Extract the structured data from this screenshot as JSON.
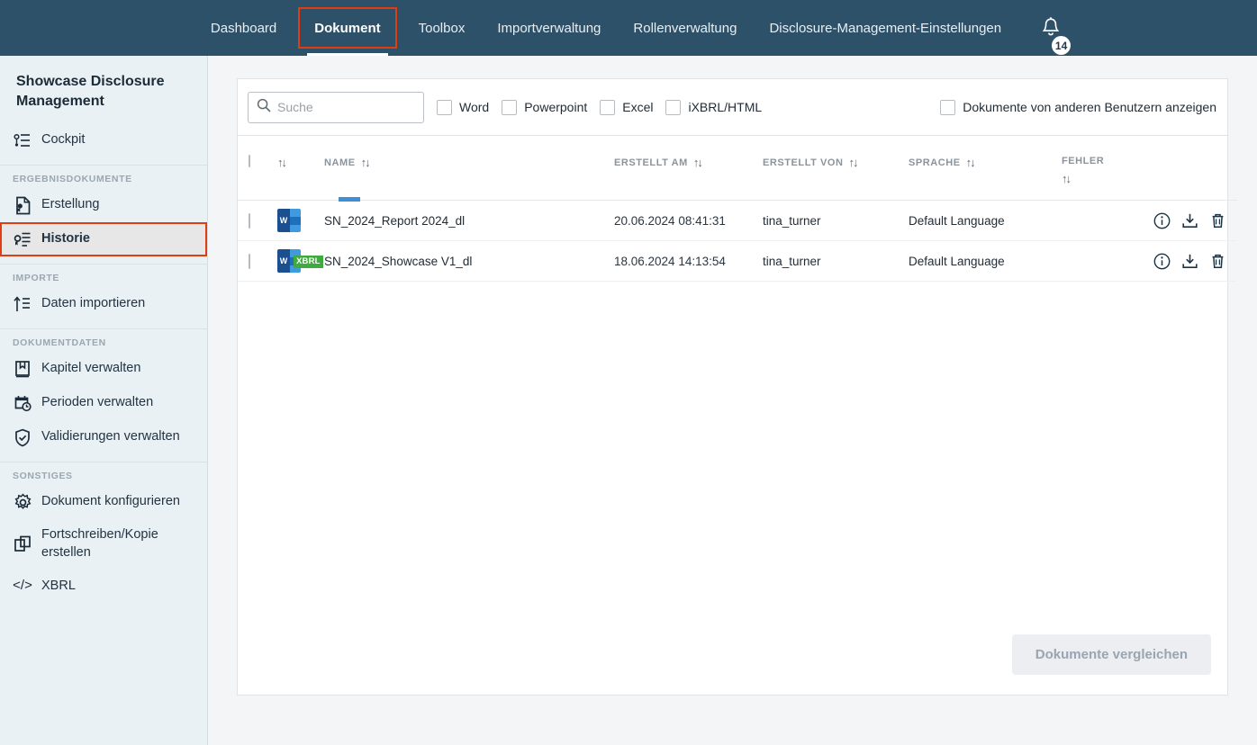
{
  "topnav": {
    "items": [
      {
        "label": "Dashboard",
        "active": false
      },
      {
        "label": "Dokument",
        "active": true
      },
      {
        "label": "Toolbox",
        "active": false
      },
      {
        "label": "Importverwaltung",
        "active": false
      },
      {
        "label": "Rollenverwaltung",
        "active": false
      },
      {
        "label": "Disclosure-Management-Einstellungen",
        "active": false
      }
    ],
    "notification_count": "14",
    "bar_color": "#2d5169",
    "active_highlight_color": "#e03e12"
  },
  "sidebar": {
    "title": "Showcase Disclosure Management",
    "groups": [
      {
        "label": "",
        "items": [
          {
            "label": "Cockpit",
            "icon": "cockpit-icon",
            "active": false
          }
        ]
      },
      {
        "label": "ERGEBNISDOKUMENTE",
        "items": [
          {
            "label": "Erstellung",
            "icon": "document-create-icon",
            "active": false
          },
          {
            "label": "Historie",
            "icon": "document-history-icon",
            "active": true
          }
        ]
      },
      {
        "label": "IMPORTE",
        "items": [
          {
            "label": "Daten importieren",
            "icon": "import-data-icon",
            "active": false
          }
        ]
      },
      {
        "label": "DOKUMENTDATEN",
        "items": [
          {
            "label": "Kapitel verwalten",
            "icon": "book-icon",
            "active": false
          },
          {
            "label": "Perioden verwalten",
            "icon": "calendar-clock-icon",
            "active": false
          },
          {
            "label": "Validierungen verwalten",
            "icon": "shield-check-icon",
            "active": false
          }
        ]
      },
      {
        "label": "SONSTIGES",
        "items": [
          {
            "label": "Dokument konfigurieren",
            "icon": "gear-icon",
            "active": false
          },
          {
            "label": "Fortschreiben/Kopie erstellen",
            "icon": "copy-icon",
            "active": false
          },
          {
            "label": "XBRL",
            "icon": "code-icon",
            "active": false
          }
        ]
      }
    ]
  },
  "filterbar": {
    "search": {
      "value": "",
      "placeholder": "Suche",
      "icon": "search-icon"
    },
    "filters": [
      {
        "label": "Word",
        "checked": false
      },
      {
        "label": "Powerpoint",
        "checked": false
      },
      {
        "label": "Excel",
        "checked": false
      },
      {
        "label": "iXBRL/HTML",
        "checked": false
      }
    ],
    "show_others": {
      "label": "Dokumente von anderen Benutzern anzeigen",
      "checked": false
    }
  },
  "table": {
    "columns": [
      {
        "label": "",
        "sortable": false
      },
      {
        "label": "",
        "sortable": true
      },
      {
        "label": "NAME",
        "sortable": true
      },
      {
        "label": "ERSTELLT AM",
        "sortable": true
      },
      {
        "label": "ERSTELLT VON",
        "sortable": true
      },
      {
        "label": "SPRACHE",
        "sortable": true
      },
      {
        "label": "FEHLER",
        "sortable": true
      },
      {
        "label": "",
        "sortable": false
      }
    ],
    "rows": [
      {
        "selected": false,
        "file_type": "word",
        "has_xbrl": false,
        "xbrl_label": "XBRL",
        "name": "SN_2024_Report 2024_dl",
        "created_at": "20.06.2024 08:41:31",
        "created_by": "tina_turner",
        "language": "Default Language",
        "errors": "",
        "actions": [
          "info-icon",
          "download-icon",
          "delete-icon"
        ]
      },
      {
        "selected": false,
        "file_type": "word",
        "has_xbrl": true,
        "xbrl_label": "XBRL",
        "name": "SN_2024_Showcase V1_dl",
        "created_at": "18.06.2024 14:13:54",
        "created_by": "tina_turner",
        "language": "Default Language",
        "errors": "",
        "actions": [
          "info-icon",
          "download-icon",
          "delete-icon"
        ]
      }
    ]
  },
  "footer": {
    "compare_button": {
      "label": "Dokumente vergleichen",
      "disabled": true
    }
  }
}
